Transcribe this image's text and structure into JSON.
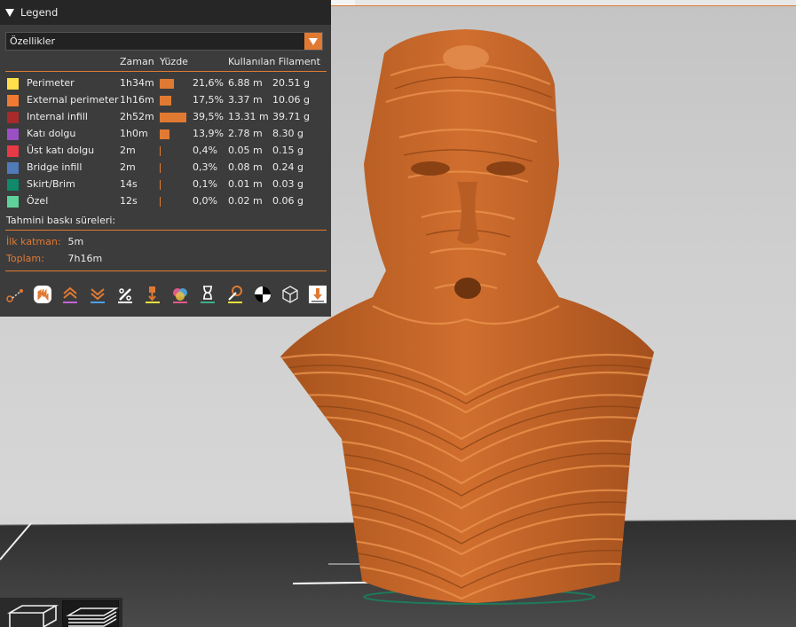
{
  "legend": {
    "title": "Legend",
    "dropdown_value": "Özellikler",
    "columns": {
      "time": "Zaman",
      "percent": "Yüzde",
      "filament": "Kullanılan Filament"
    },
    "rows": [
      {
        "label": "Perimeter",
        "color": "#ffe04a",
        "time": "1h34m",
        "percent": "21,6%",
        "fraction": 0.216,
        "length": "6.88 m",
        "weight": "20.51 g"
      },
      {
        "label": "External perimeter",
        "color": "#f07a32",
        "time": "1h16m",
        "percent": "17,5%",
        "fraction": 0.175,
        "length": "3.37 m",
        "weight": "10.06 g"
      },
      {
        "label": "Internal infill",
        "color": "#a82a2a",
        "time": "2h52m",
        "percent": "39,5%",
        "fraction": 0.395,
        "length": "13.31 m",
        "weight": "39.71 g"
      },
      {
        "label": "Katı dolgu",
        "color": "#9a4fc4",
        "time": "1h0m",
        "percent": "13,9%",
        "fraction": 0.139,
        "length": "2.78 m",
        "weight": "8.30 g"
      },
      {
        "label": "Üst katı dolgu",
        "color": "#e83a46",
        "time": "2m",
        "percent": "0,4%",
        "fraction": 0.004,
        "length": "0.05 m",
        "weight": "0.15 g"
      },
      {
        "label": "Bridge infill",
        "color": "#4f7cb8",
        "time": "2m",
        "percent": "0,3%",
        "fraction": 0.003,
        "length": "0.08 m",
        "weight": "0.24 g"
      },
      {
        "label": "Skirt/Brim",
        "color": "#0f8a6a",
        "time": "14s",
        "percent": "0,1%",
        "fraction": 0.001,
        "length": "0.01 m",
        "weight": "0.03 g"
      },
      {
        "label": "Özel",
        "color": "#5ed29a",
        "time": "12s",
        "percent": "0,0%",
        "fraction": 0.0,
        "length": "0.02 m",
        "weight": "0.06 g"
      }
    ],
    "estimates_title": "Tahmini baskı süreleri:",
    "first_layer_label": "İlk katman:",
    "first_layer_value": "5m",
    "total_label": "Toplam:",
    "total_value": "7h16m"
  },
  "toolbar_icons": [
    "travel-icon",
    "retractions-icon",
    "deretractions-icon",
    "wipe-icon",
    "seams-icon",
    "tool-changes-icon",
    "color-changes-icon",
    "pause-prints-icon",
    "custom-gcodes-icon",
    "center-of-gravity-icon",
    "shells-icon",
    "tool-marker-icon"
  ],
  "colors": {
    "accent": "#e07a32",
    "model": "#c8652a",
    "panel": "#3c3c3c"
  }
}
